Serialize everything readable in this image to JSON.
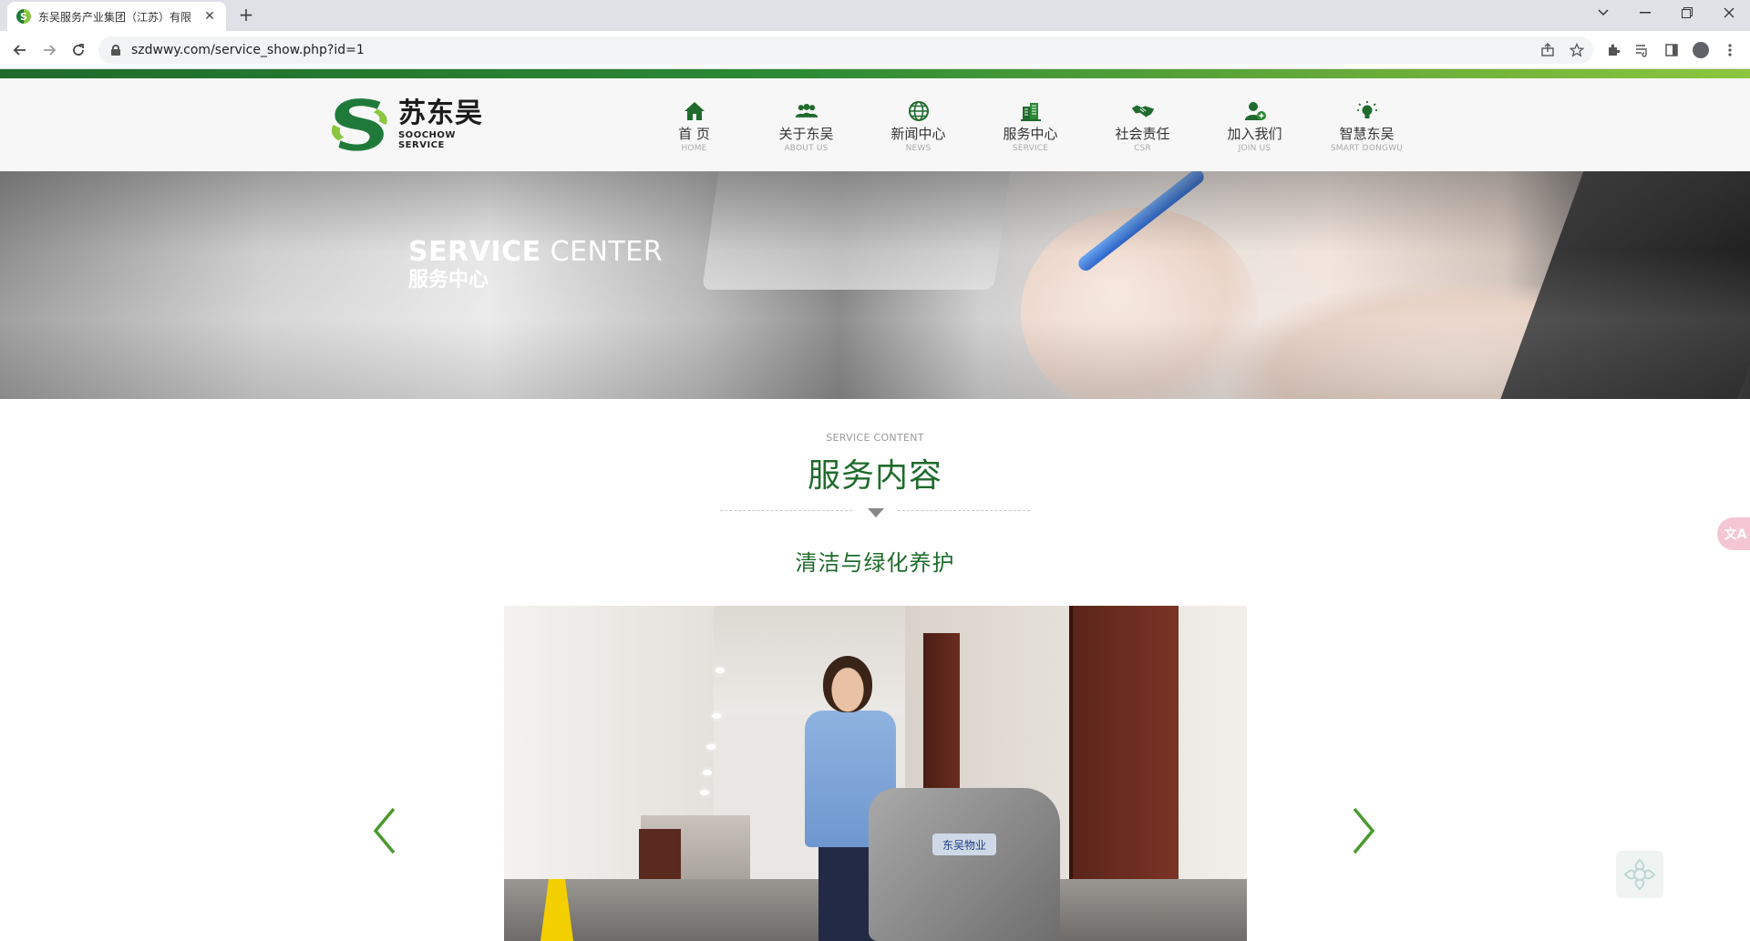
{
  "browser": {
    "tab_title": "东吴服务产业集团（江苏）有限",
    "tab_close": "✕",
    "new_tab": "+",
    "url": "szdwwy.com/service_show.php?id=1"
  },
  "logo": {
    "name_cn": "苏东吴",
    "name_en": "SOOCHOW SERVICE"
  },
  "nav": [
    {
      "cn": "首 页",
      "en": "HOME",
      "icon": "home-icon"
    },
    {
      "cn": "关于东吴",
      "en": "ABOUT US",
      "icon": "people-icon"
    },
    {
      "cn": "新闻中心",
      "en": "NEWS",
      "icon": "globe-icon"
    },
    {
      "cn": "服务中心",
      "en": "SERVICE",
      "icon": "building-icon"
    },
    {
      "cn": "社会责任",
      "en": "CSR",
      "icon": "handshake-icon"
    },
    {
      "cn": "加入我们",
      "en": "JOIN US",
      "icon": "add-user-icon"
    },
    {
      "cn": "智慧东吴",
      "en": "SMART DONGWU",
      "icon": "lightbulb-icon"
    }
  ],
  "banner": {
    "title_en_bold": "SERVICE",
    "title_en_rest": " CENTER",
    "title_cn": "服务中心"
  },
  "section": {
    "label_en": "SERVICE CONTENT",
    "title_cn": "服务内容",
    "subtitle": "清洁与绿化养护"
  },
  "photo": {
    "machine_label": "东吴物业"
  },
  "side_button": {
    "label": "文A"
  },
  "colors": {
    "brand_green": "#1f6b2c",
    "accent_green": "#8cc63f",
    "arrow_green": "#4a9a2e"
  }
}
